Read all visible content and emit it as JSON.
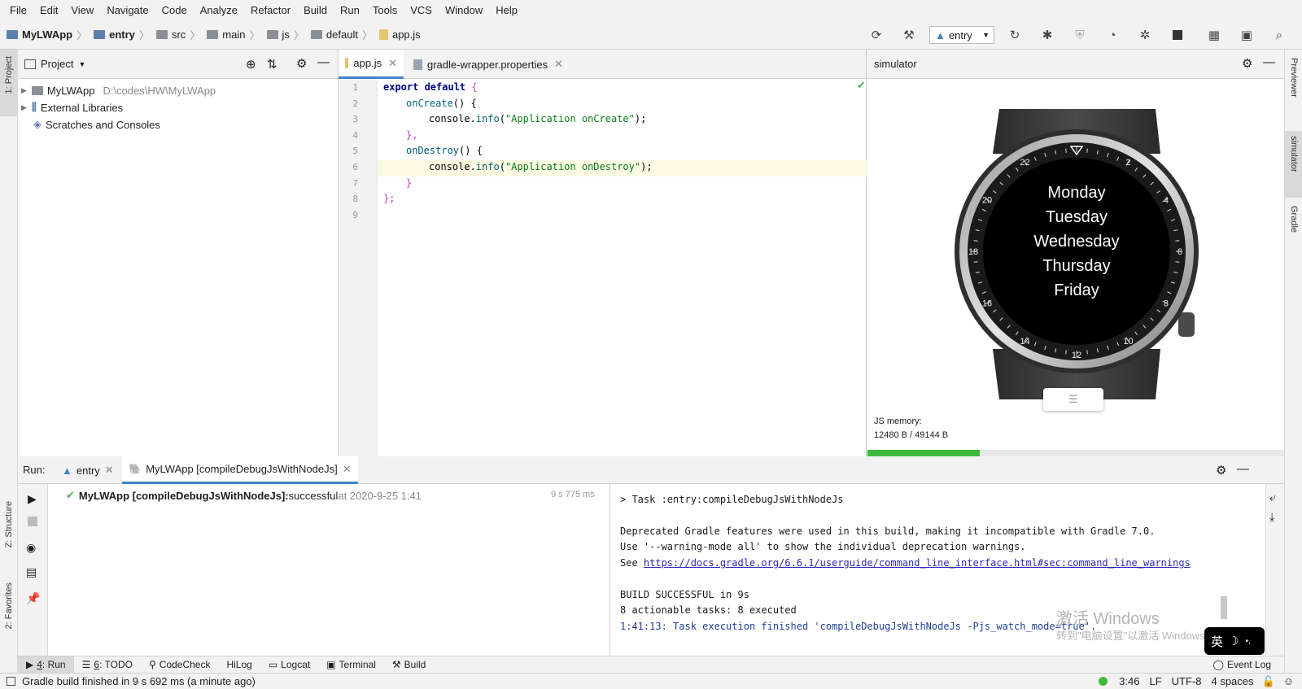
{
  "menu": [
    "File",
    "Edit",
    "View",
    "Navigate",
    "Code",
    "Analyze",
    "Refactor",
    "Build",
    "Run",
    "Tools",
    "VCS",
    "Window",
    "Help"
  ],
  "breadcrumbs": [
    "MyLWApp",
    "entry",
    "src",
    "main",
    "js",
    "default",
    "app.js"
  ],
  "toolbar": {
    "run_config": "entry"
  },
  "left_stripe": {
    "project": "1: Project",
    "structure": "Z: Structure",
    "favorites": "2: Favorites"
  },
  "right_stripe": {
    "previewer": "Previewer",
    "simulator": "simulator",
    "gradle": "Gradle"
  },
  "project_panel": {
    "title": "Project",
    "tree": [
      {
        "label": "MyLWApp",
        "path": "D:\\codes\\HW\\MyLWApp"
      },
      {
        "label": "External Libraries",
        "path": ""
      },
      {
        "label": "Scratches and Consoles",
        "path": ""
      }
    ]
  },
  "editor": {
    "tabs": [
      "app.js",
      "gradle-wrapper.properties"
    ],
    "line_numbers": [
      "1",
      "2",
      "3",
      "4",
      "5",
      "6",
      "7",
      "8",
      "9"
    ],
    "lines": {
      "l1_kw": "export default",
      "l1_rest": " {",
      "l2_fn": "onCreate",
      "l2_rest": "() {",
      "l3_pre": "console.",
      "l3_fn": "info",
      "l3_str": "\"Application onCreate\"",
      "l3_end": ");",
      "l4": "},",
      "l5_fn": "onDestroy",
      "l5_rest": "() {",
      "l6_pre": "console.",
      "l6_fn": "info",
      "l6_str": "\"Application onDestroy\"",
      "l6_end": ");",
      "l7": "}",
      "l8": "};",
      "paren": "("
    }
  },
  "simulator": {
    "title": "simulator",
    "watch_days": [
      "Monday",
      "Tuesday",
      "Wednesday",
      "Thursday",
      "Friday"
    ],
    "bezel_numbers": [
      "2",
      "4",
      "6",
      "8",
      "10",
      "12",
      "14",
      "16",
      "18",
      "20",
      "22"
    ],
    "memory_label": "JS memory:",
    "memory_value": "12480 B / 49144 B",
    "progress_fraction": 0.27
  },
  "run_panel": {
    "label": "Run:",
    "tabs": [
      "entry",
      "MyLWApp [compileDebugJsWithNodeJs]"
    ],
    "tree": {
      "task": "MyLWApp [compileDebugJsWithNodeJs]:",
      "status": " successful",
      "time_at": " at 2020-9-25 1:41",
      "duration": "9 s 775 ms"
    },
    "console": {
      "task": "> Task :entry:compileDebugJsWithNodeJs",
      "dep1": "Deprecated Gradle features were used in this build, making it incompatible with Gradle 7.0.",
      "dep2": "Use '--warning-mode all' to show the individual deprecation warnings.",
      "see": "See ",
      "link": "https://docs.gradle.org/6.6.1/userguide/command_line_interface.html#sec:command_line_warnings",
      "build": "BUILD SUCCESSFUL in 9s",
      "tasks": "8 actionable tasks: 8 executed",
      "finished": "1:41:13: Task execution finished 'compileDebugJsWithNodeJs -Pjs_watch_mode=true'."
    }
  },
  "watermark": {
    "line1": "激活 Windows",
    "line2": "转到\"电脑设置\"以激活 Windows。",
    "ime": "英"
  },
  "tool_tabs": [
    {
      "num": "4",
      "label": ": Run"
    },
    {
      "num": "6",
      "label": ": TODO"
    },
    {
      "num": "",
      "label": "CodeCheck"
    },
    {
      "num": "",
      "label": "HiLog"
    },
    {
      "num": "",
      "label": "Logcat"
    },
    {
      "num": "",
      "label": "Terminal"
    },
    {
      "num": "",
      "label": "Build"
    }
  ],
  "event_log": "Event Log",
  "status_bar": {
    "message": "Gradle build finished in 9 s 692 ms (a minute ago)",
    "position": "3:46",
    "line_sep": "LF",
    "encoding": "UTF-8",
    "indent": "4 spaces"
  },
  "colors": {
    "accent": "#4083c9",
    "success": "#4caf50",
    "progress": "#3fb93f",
    "link": "#2a2ab8"
  }
}
